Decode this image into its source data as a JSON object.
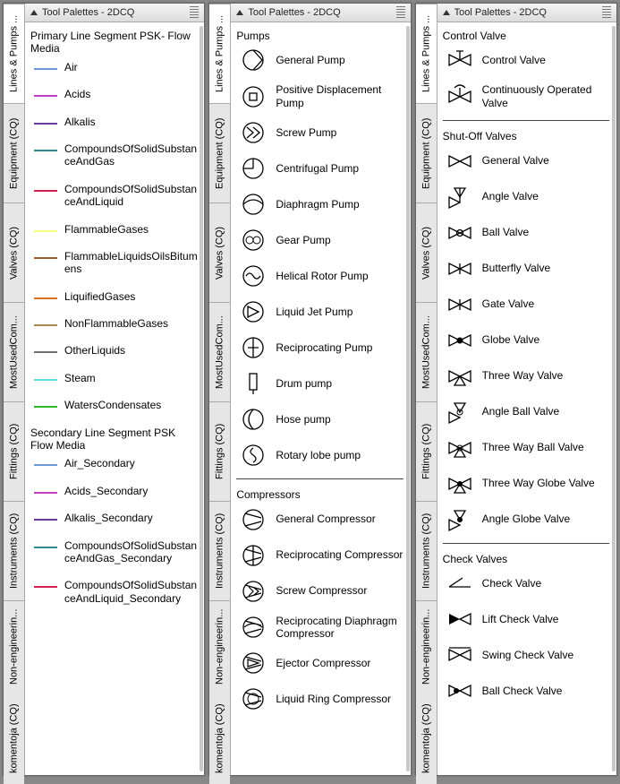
{
  "palettes": [
    {
      "title": "Tool Palettes - 2DCQ",
      "tabs": [
        {
          "label": "Lines & Pumps ...",
          "active": true
        },
        {
          "label": "Equipment (CQ)",
          "active": false
        },
        {
          "label": "Valves (CQ)",
          "active": false
        },
        {
          "label": "MostUsedCom...",
          "active": false
        },
        {
          "label": "Fittings  (CQ)",
          "active": false
        },
        {
          "label": "Instruments (CQ)",
          "active": false
        },
        {
          "label": "Non-engineerin...",
          "active": false
        },
        {
          "label": "komentoja (CQ)",
          "active": false
        }
      ],
      "sections": [
        {
          "title": "Primary Line Segment PSK- Flow Media",
          "type": "lines",
          "items": [
            {
              "label": "Air",
              "color": "#6b99d6"
            },
            {
              "label": "Acids",
              "color": "#c040c0"
            },
            {
              "label": "Alkalis",
              "color": "#6b3aa0"
            },
            {
              "label": "CompoundsOfSolidSubstanceAndGas",
              "color": "#2e8b8b"
            },
            {
              "label": "CompoundsOfSolidSubstanceAndLiquid",
              "color": "#d02050"
            },
            {
              "label": "FlammableGases",
              "color": "#fdfd80"
            },
            {
              "label": "FlammableLiquidsOilsBitumens",
              "color": "#a05a2c"
            },
            {
              "label": "LiquifiedGases",
              "color": "#d86f1a"
            },
            {
              "label": "NonFlammableGases",
              "color": "#a88850"
            },
            {
              "label": "OtherLiquids",
              "color": "#707070"
            },
            {
              "label": "Steam",
              "color": "#62e0e0"
            },
            {
              "label": "WatersCondensates",
              "color": "#2bb82b"
            }
          ]
        },
        {
          "title": "Secondary Line Segment PSK Flow Media",
          "type": "lines",
          "items": [
            {
              "label": "Air_Secondary",
              "color": "#6b99d6"
            },
            {
              "label": "Acids_Secondary",
              "color": "#c040c0"
            },
            {
              "label": "Alkalis_Secondary",
              "color": "#6b3aa0"
            },
            {
              "label": "CompoundsOfSolidSubstanceAndGas_Secondary",
              "color": "#2e8b8b"
            },
            {
              "label": "CompoundsOfSolidSubstanceAndLiquid_Secondary",
              "color": "#d02050"
            }
          ]
        }
      ]
    },
    {
      "title": "Tool Palettes - 2DCQ",
      "tabs": [
        {
          "label": "Lines & Pumps ...",
          "active": true
        },
        {
          "label": "Equipment (CQ)",
          "active": false
        },
        {
          "label": "Valves (CQ)",
          "active": false
        },
        {
          "label": "MostUsedCom...",
          "active": false
        },
        {
          "label": "Fittings  (CQ)",
          "active": false
        },
        {
          "label": "Instruments (CQ)",
          "active": false
        },
        {
          "label": "Non-engineerin...",
          "active": false
        },
        {
          "label": "komentoja (CQ)",
          "active": false
        }
      ],
      "sections": [
        {
          "title": "Pumps",
          "type": "symbols",
          "items": [
            {
              "label": "General Pump",
              "icon": "pump-general"
            },
            {
              "label": "Positive Displacement Pump",
              "icon": "pump-pd"
            },
            {
              "label": "Screw Pump",
              "icon": "pump-screw"
            },
            {
              "label": "Centrifugal Pump",
              "icon": "pump-centrifugal"
            },
            {
              "label": "Diaphragm Pump",
              "icon": "pump-diaphragm"
            },
            {
              "label": "Gear Pump",
              "icon": "pump-gear"
            },
            {
              "label": "Helical Rotor Pump",
              "icon": "pump-helical"
            },
            {
              "label": "Liquid Jet Pump",
              "icon": "pump-liquidjet"
            },
            {
              "label": "Reciprocating Pump",
              "icon": "pump-recip"
            },
            {
              "label": "Drum pump",
              "icon": "pump-drum"
            },
            {
              "label": "Hose pump",
              "icon": "pump-hose"
            },
            {
              "label": "Rotary lobe pump",
              "icon": "pump-lobe"
            }
          ]
        },
        {
          "title": "Compressors",
          "type": "symbols",
          "hr": true,
          "items": [
            {
              "label": "General Compressor",
              "icon": "comp-general"
            },
            {
              "label": "Reciprocating Compressor",
              "icon": "comp-recip"
            },
            {
              "label": "Screw Compressor",
              "icon": "comp-screw"
            },
            {
              "label": "Reciprocating Diaphragm Compressor",
              "icon": "comp-diaphragm"
            },
            {
              "label": "Ejector Compressor",
              "icon": "comp-ejector"
            },
            {
              "label": "Liquid Ring Compressor",
              "icon": "comp-liquidring"
            }
          ]
        }
      ]
    },
    {
      "title": "Tool Palettes - 2DCQ",
      "tabs": [
        {
          "label": "Lines & Pumps ...",
          "active": true
        },
        {
          "label": "Equipment (CQ)",
          "active": false
        },
        {
          "label": "Valves (CQ)",
          "active": false
        },
        {
          "label": "MostUsedCom...",
          "active": false
        },
        {
          "label": "Fittings  (CQ)",
          "active": false
        },
        {
          "label": "Instruments (CQ)",
          "active": false
        },
        {
          "label": "Non-engineerin...",
          "active": false
        },
        {
          "label": "komentoja (CQ)",
          "active": false
        }
      ],
      "sections": [
        {
          "title": "Control Valve",
          "type": "symbols",
          "items": [
            {
              "label": "Control Valve",
              "icon": "valve-control"
            },
            {
              "label": "Continuously Operated Valve",
              "icon": "valve-cont"
            }
          ]
        },
        {
          "title": "Shut-Off Valves",
          "type": "symbols",
          "hr": true,
          "items": [
            {
              "label": "General Valve",
              "icon": "valve-general"
            },
            {
              "label": "Angle Valve",
              "icon": "valve-angle"
            },
            {
              "label": "Ball Valve",
              "icon": "valve-ball"
            },
            {
              "label": "Butterfly Valve",
              "icon": "valve-butterfly"
            },
            {
              "label": "Gate Valve",
              "icon": "valve-gate"
            },
            {
              "label": "Globe Valve",
              "icon": "valve-globe"
            },
            {
              "label": "Three Way Valve",
              "icon": "valve-3way"
            },
            {
              "label": "Angle Ball Valve",
              "icon": "valve-angleball"
            },
            {
              "label": "Three Way Ball Valve",
              "icon": "valve-3wayball"
            },
            {
              "label": "Three Way Globe Valve",
              "icon": "valve-3wayglobe"
            },
            {
              "label": "Angle Globe Valve",
              "icon": "valve-angleglobe"
            }
          ]
        },
        {
          "title": "Check Valves",
          "type": "symbols",
          "hr": true,
          "items": [
            {
              "label": "Check Valve",
              "icon": "valve-check"
            },
            {
              "label": "Lift Check Valve",
              "icon": "valve-liftcheck"
            },
            {
              "label": "Swing Check Valve",
              "icon": "valve-swingcheck"
            },
            {
              "label": "Ball Check Valve",
              "icon": "valve-ballcheck"
            }
          ]
        }
      ]
    }
  ]
}
